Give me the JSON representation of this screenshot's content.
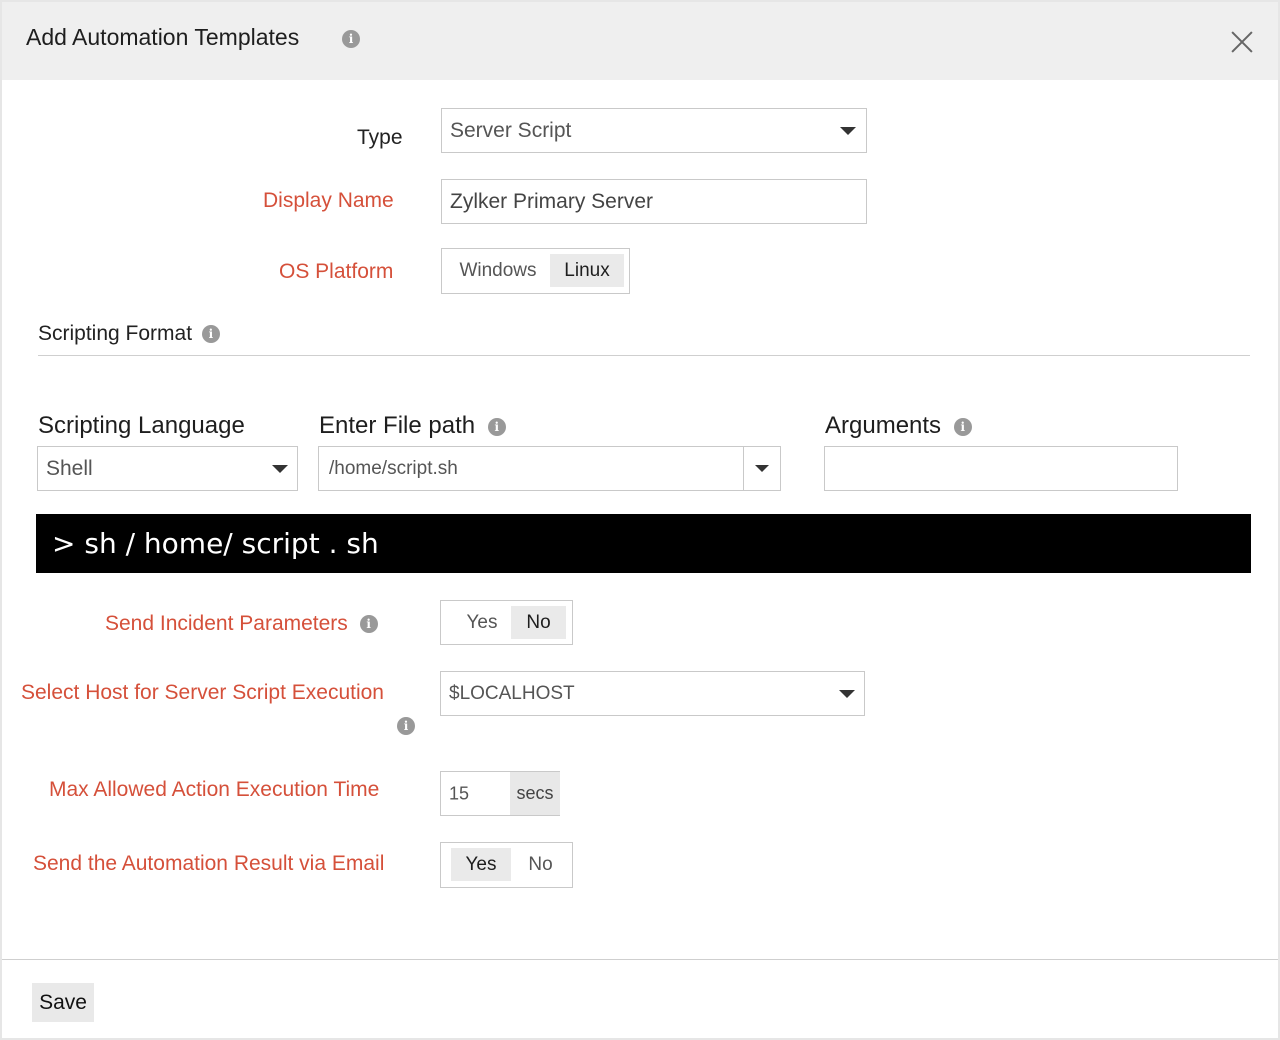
{
  "dialog": {
    "title": "Add Automation Templates",
    "info_icon": "info-icon",
    "close_icon": "close-icon"
  },
  "type": {
    "label": "Type",
    "value": "Server Script"
  },
  "display_name": {
    "label": "Display Name",
    "value": "Zylker Primary Server"
  },
  "os_platform": {
    "label": "OS Platform",
    "options": [
      "Windows",
      "Linux"
    ],
    "selected": "Linux"
  },
  "scripting_format": {
    "title": "Scripting Format"
  },
  "scripting_language": {
    "label": "Scripting Language",
    "value": "Shell"
  },
  "file_path": {
    "label": "Enter File path",
    "value": "/home/script.sh"
  },
  "arguments": {
    "label": "Arguments",
    "value": ""
  },
  "console": {
    "text": "> sh / home/ script . sh"
  },
  "send_incident_params": {
    "label": "Send Incident Parameters",
    "options": [
      "Yes",
      "No"
    ],
    "selected": "No"
  },
  "select_host": {
    "label": "Select Host for Server Script Execution",
    "value": "$LOCALHOST"
  },
  "max_time": {
    "label": "Max Allowed Action Execution Time",
    "value": "15",
    "unit": "secs"
  },
  "send_email": {
    "label": "Send the Automation Result via Email",
    "options": [
      "Yes",
      "No"
    ],
    "selected": "Yes"
  },
  "footer": {
    "save_label": "Save"
  },
  "colors": {
    "required_label": "#d5503a",
    "header_bg": "#efefef",
    "console_bg": "#000000"
  }
}
